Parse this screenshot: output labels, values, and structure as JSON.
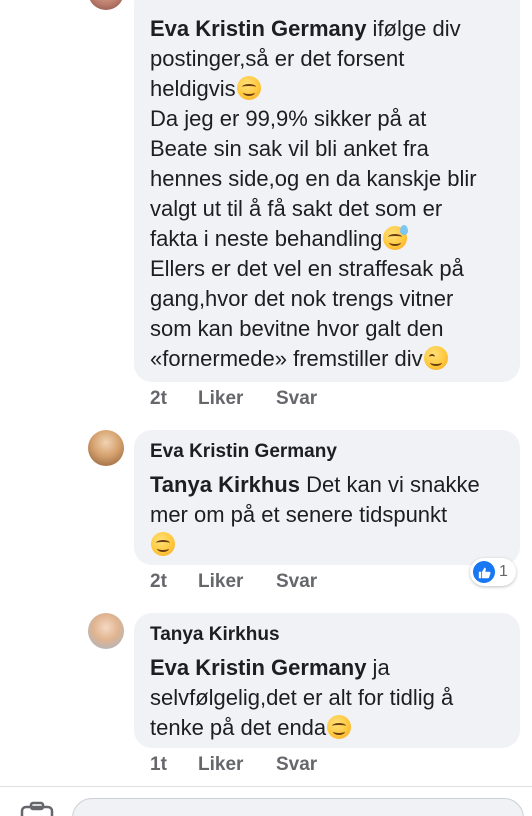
{
  "comments": [
    {
      "author": "",
      "tag": "Eva Kristin Germany",
      "lines": [
        " ifølge div",
        "postinger,så er det forsent",
        "heldigvis",
        "Da jeg er 99,9% sikker på at",
        "Beate sin sak vil bli anket fra",
        "hennes side,og en da kanskje blir",
        "valgt ut til å få sakt det som er",
        "fakta i neste behandling",
        "Ellers er det vel en straffesak på",
        "gang,hvor det nok trengs vitner",
        "som kan bevitne hvor galt den",
        "«fornermede» fremstiller div"
      ],
      "time": "2t",
      "like": "Liker",
      "reply": "Svar"
    },
    {
      "author": "Eva Kristin Germany",
      "tag": "Tanya Kirkhus",
      "lines": [
        " Det kan vi snakke",
        "mer om på et senere tidspunkt"
      ],
      "time": "2t",
      "like": "Liker",
      "reply": "Svar",
      "reaction_count": "1"
    },
    {
      "author": "Tanya Kirkhus",
      "tag": "Eva Kristin Germany",
      "lines": [
        " ja",
        "selvfølgelig,det er alt for tidlig å",
        "tenke på det enda"
      ],
      "time": "1t",
      "like": "Liker",
      "reply": "Svar"
    }
  ],
  "icons": {
    "emoji_smile": "smiling-face-emoji",
    "emoji_sweat": "grinning-sweat-emoji",
    "emoji_wink": "winking-face-emoji",
    "like": "thumbs-up-icon",
    "camera": "camera-icon"
  },
  "colors": {
    "bubble": "#f0f2f5",
    "muted": "#65676b",
    "like_blue": "#1877f2"
  }
}
